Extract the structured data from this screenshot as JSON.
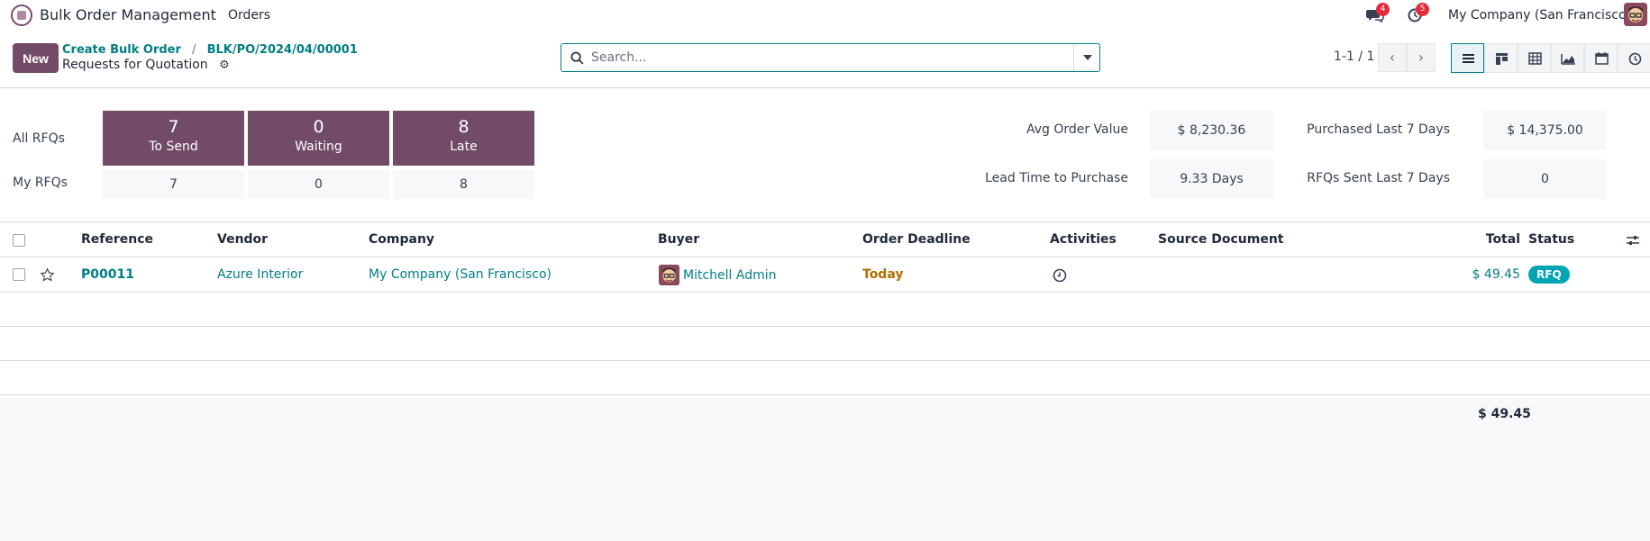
{
  "app": {
    "title": "Bulk Order Management",
    "menu_orders": "Orders"
  },
  "systray": {
    "messages_count": "4",
    "activities_count": "5",
    "company": "My Company (San Francisco)"
  },
  "breadcrumb": {
    "item1": "Create Bulk Order",
    "separator": "/",
    "item2": "BLK/PO/2024/04/00001",
    "current": "Requests for Quotation"
  },
  "control": {
    "new_label": "New",
    "search_placeholder": "Search...",
    "pager": "1-1 / 1"
  },
  "dashboard": {
    "all_rfqs_label": "All RFQs",
    "my_rfqs_label": "My RFQs",
    "tiles": [
      {
        "value": "7",
        "label": "To Send",
        "my_value": "7"
      },
      {
        "value": "0",
        "label": "Waiting",
        "my_value": "0"
      },
      {
        "value": "8",
        "label": "Late",
        "my_value": "8"
      }
    ],
    "kpis": {
      "avg_order_label": "Avg Order Value",
      "avg_order_value": "$ 8,230.36",
      "lead_time_label": "Lead Time to Purchase",
      "lead_time_value": "9.33 Days",
      "purchased_label": "Purchased Last 7 Days",
      "purchased_value": "$ 14,375.00",
      "rfqs_sent_label": "RFQs Sent Last 7 Days",
      "rfqs_sent_value": "0"
    }
  },
  "table": {
    "columns": {
      "reference": "Reference",
      "vendor": "Vendor",
      "company": "Company",
      "buyer": "Buyer",
      "deadline": "Order Deadline",
      "activities": "Activities",
      "source": "Source Document",
      "total": "Total",
      "status": "Status"
    },
    "rows": [
      {
        "reference": "P00011",
        "vendor": "Azure Interior",
        "company": "My Company (San Francisco)",
        "buyer": "Mitchell Admin",
        "deadline": "Today",
        "total": "$ 49.45",
        "status": "RFQ"
      }
    ],
    "footer_total": "$ 49.45"
  },
  "colors": {
    "brand": "#714b67",
    "link": "#017e84",
    "status_rfq": "#00a5b4",
    "today": "#b06e00"
  }
}
